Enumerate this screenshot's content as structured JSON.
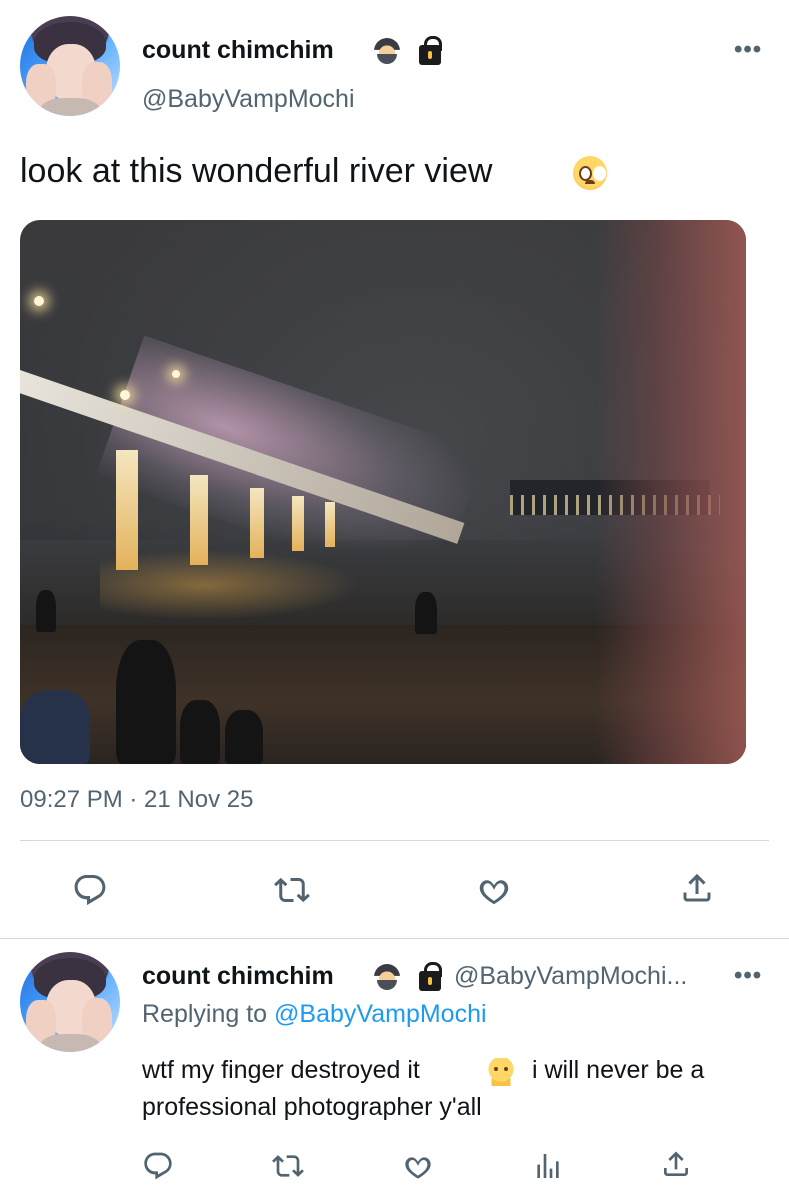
{
  "main_tweet": {
    "author_name": "count chimchim",
    "author_handle": "@BabyVampMochi",
    "text": "look at this wonderful river view",
    "more_label": "•••",
    "timestamp": "09:27 PM · 21 Nov 25",
    "actions": [
      "reply-icon",
      "retweet-icon",
      "like-icon",
      "share-icon"
    ]
  },
  "reply_tweet": {
    "author_name": "count chimchim",
    "author_handle": "@BabyVampMochi...",
    "more_label": "•••",
    "replying_prefix": "Replying to",
    "replying_handle": "@BabyVampMochi",
    "text_part1": "wtf my finger destroyed it",
    "text_part2": "i will never be a",
    "text_line2": "professional photographer y'all",
    "actions": [
      "reply-icon",
      "retweet-icon",
      "like-icon",
      "analytics-icon",
      "share-icon"
    ]
  },
  "colors": {
    "text_primary": "#0f1419",
    "text_secondary": "#536471",
    "link": "#1d9bf0",
    "divider": "#cfd9de"
  }
}
